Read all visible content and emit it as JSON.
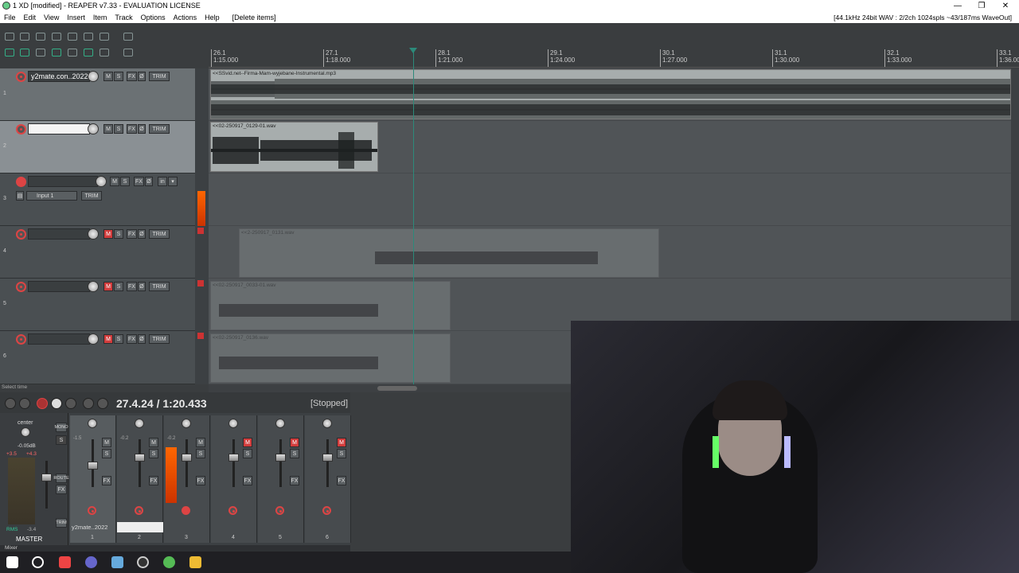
{
  "window": {
    "title": "1 XD [modified] - REAPER v7.33 - EVALUATION LICENSE",
    "minimize": "—",
    "maximize": "❐",
    "close": "✕"
  },
  "menu": {
    "items": [
      "File",
      "Edit",
      "View",
      "Insert",
      "Item",
      "Track",
      "Options",
      "Actions",
      "Help",
      "[Delete items]"
    ],
    "status": "[44.1kHz 24bit WAV : 2/2ch 1024spls ~43/187ms WaveOut]"
  },
  "ruler": {
    "ticks": [
      {
        "bar": "26.1",
        "time": "1:15.000"
      },
      {
        "bar": "27.1",
        "time": "1:18.000"
      },
      {
        "bar": "28.1",
        "time": "1:21.000"
      },
      {
        "bar": "29.1",
        "time": "1:24.000"
      },
      {
        "bar": "30.1",
        "time": "1:27.000"
      },
      {
        "bar": "31.1",
        "time": "1:30.000"
      },
      {
        "bar": "32.1",
        "time": "1:33.000"
      },
      {
        "bar": "33.1",
        "time": "1:36.000"
      }
    ]
  },
  "tracks": [
    {
      "num": "1",
      "name": "y2mate.con..2022",
      "input": ""
    },
    {
      "num": "2",
      "name": "",
      "input": ""
    },
    {
      "num": "3",
      "name": "",
      "input": "Input 1"
    },
    {
      "num": "4",
      "name": "",
      "input": ""
    },
    {
      "num": "5",
      "name": "",
      "input": ""
    },
    {
      "num": "6",
      "name": "",
      "input": ""
    }
  ],
  "buttons": {
    "mute": "M",
    "solo": "S",
    "fx": "FX",
    "phase": "Ø",
    "trim": "TRIM",
    "in": "in"
  },
  "items": [
    {
      "label": "<<SSvid.net--Firma-Mam-wyjebane-Instrumental.mp3"
    },
    {
      "label": "<<02-250917_0129-01.wav"
    },
    {
      "label": "<<2-250917_0131.wav"
    },
    {
      "label": "<<02-250917_0033-01.wav"
    },
    {
      "label": "<<02-250917_0136.wav"
    }
  ],
  "statusline": "Select time",
  "transport": {
    "time": "27.4.24 / 1:20.433",
    "state": "[Stopped]"
  },
  "mixer": {
    "master_label": "MASTER",
    "center": "center",
    "master_db": "-0.05dB",
    "meter_vals": [
      "+3.5",
      "+4.3"
    ],
    "rms": "RMS",
    "rms_val": "-3.4",
    "mono": "MONO",
    "route": "ROUTE",
    "channels": [
      {
        "num": "1",
        "name": "y2mate..2022",
        "vol": "-1.5"
      },
      {
        "num": "2",
        "name": "",
        "vol": "-0.2"
      },
      {
        "num": "3",
        "name": "",
        "vol": "-0.2"
      },
      {
        "num": "4",
        "name": "",
        "vol": ""
      },
      {
        "num": "5",
        "name": "",
        "vol": ""
      },
      {
        "num": "6",
        "name": "",
        "vol": ""
      }
    ],
    "tab": "Mixer"
  }
}
